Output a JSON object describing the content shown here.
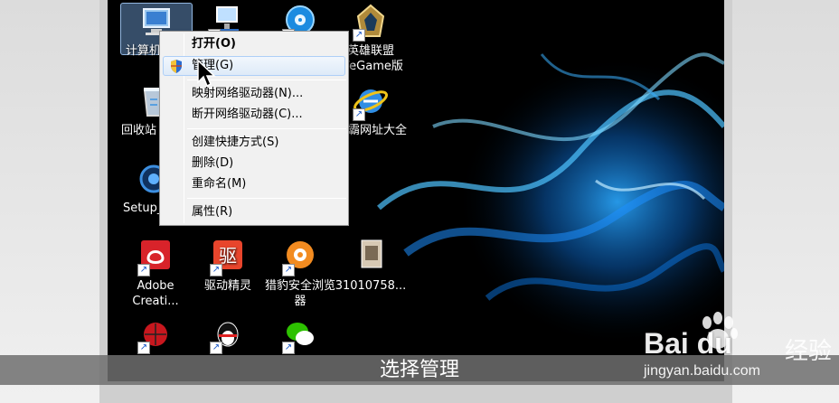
{
  "desktop": {
    "icons": [
      {
        "label": "计算机",
        "icon": "computer-icon"
      },
      {
        "label": "",
        "icon": "network-shortcut-icon"
      },
      {
        "label": "",
        "icon": "media-player-icon"
      },
      {
        "label": "英雄联盟\nWeGame版",
        "icon": "league-of-legends-icon"
      },
      {
        "label": "回收站",
        "icon": "recycle-bin-icon"
      },
      {
        "label": "霸网址大全",
        "icon": "internet-explorer-icon"
      },
      {
        "label": "Setup_",
        "icon": "setup-icon"
      },
      {
        "label": "Adobe\nCreati...",
        "icon": "adobe-creative-cloud-icon"
      },
      {
        "label": "驱动精灵",
        "icon": "driver-genius-icon"
      },
      {
        "label": "猎豹安全浏览\n器",
        "icon": "cheetah-browser-icon"
      },
      {
        "label": "31010758...",
        "icon": "image-file-icon"
      },
      {
        "label": "",
        "icon": "spiderman-icon"
      },
      {
        "label": "",
        "icon": "qq-icon"
      },
      {
        "label": "",
        "icon": "wechat-icon"
      }
    ]
  },
  "context_menu": {
    "open": "打开(O)",
    "manage": "管理(G)",
    "map_drive": "映射网络驱动器(N)...",
    "disconnect_drive": "断开网络驱动器(C)...",
    "create_shortcut": "创建快捷方式(S)",
    "delete": "删除(D)",
    "rename": "重命名(M)",
    "properties": "属性(R)"
  },
  "caption": "选择管理",
  "watermark": {
    "logo": "Bai du",
    "jingyan": "经验",
    "url": "jingyan.baidu.com"
  }
}
